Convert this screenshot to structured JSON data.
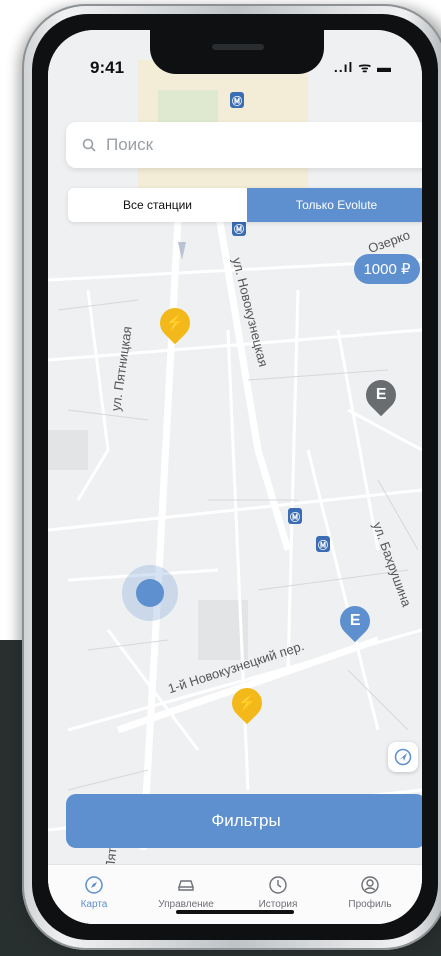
{
  "status_bar": {
    "time": "9:41",
    "icons": "..ıl ᯤ ▬"
  },
  "search": {
    "placeholder": "Поиск"
  },
  "segment": {
    "all": "Все станции",
    "evolute": "Только Evolute",
    "active": "evolute"
  },
  "price_badge": "1000 ₽",
  "streets": {
    "pyatnitskaya_top": "ул. Пятницкая",
    "novokuznetskaya": "ул. Новокузнецкая",
    "pyatnitskaya_bottom": "ул. Пятницкая",
    "novokuznetsky_per": "1-й Новокузнецкий пер.",
    "bakhrushina": "ул. Бахрушина",
    "ozerkovskaya": "Озерко"
  },
  "pins": {
    "yellow_glyph": "⚡",
    "blue_glyph": "E",
    "gray_glyph": "E",
    "metro_glyph": "Ⓜ"
  },
  "filters_button": "Фильтры",
  "tabs": [
    {
      "label": "Карта",
      "icon": "compass-icon",
      "active": true
    },
    {
      "label": "Управление",
      "icon": "car-icon",
      "active": false
    },
    {
      "label": "История",
      "icon": "clock-icon",
      "active": false
    },
    {
      "label": "Профиль",
      "icon": "user-icon",
      "active": false
    }
  ],
  "colors": {
    "accent": "#5e8fcf",
    "charger": "#f3b91a",
    "map_bg": "#eef0f2",
    "device_bg": "#28302f"
  }
}
